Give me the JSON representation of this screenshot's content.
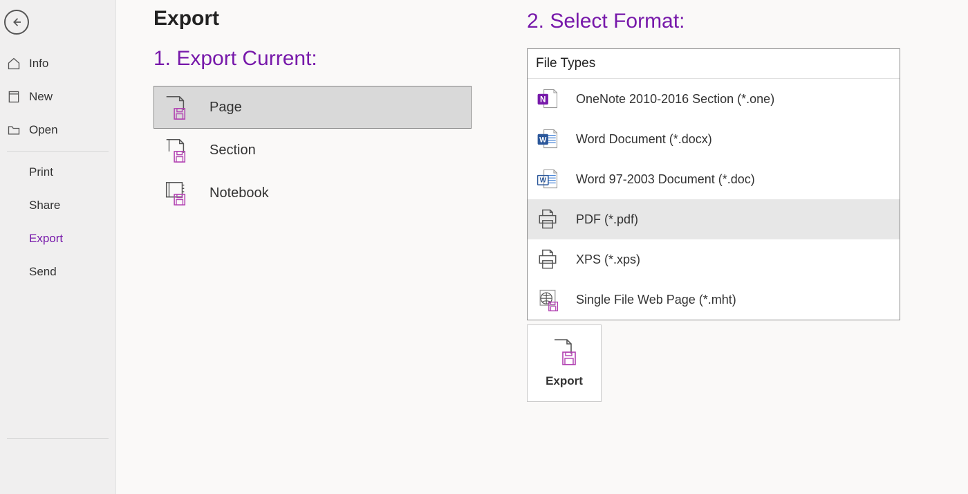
{
  "sidebar": {
    "back_label": "Back",
    "items": [
      {
        "label": "Info",
        "icon": "home-icon"
      },
      {
        "label": "New",
        "icon": "page-icon"
      },
      {
        "label": "Open",
        "icon": "folder-icon"
      }
    ],
    "sub_items": [
      {
        "label": "Print"
      },
      {
        "label": "Share"
      },
      {
        "label": "Export",
        "active": true
      },
      {
        "label": "Send"
      }
    ]
  },
  "main": {
    "title": "Export",
    "col1_heading": "1. Export Current:",
    "export_options": [
      {
        "label": "Page",
        "selected": true
      },
      {
        "label": "Section",
        "selected": false
      },
      {
        "label": "Notebook",
        "selected": false
      }
    ],
    "col2_heading": "2. Select Format:",
    "file_types_header": "File Types",
    "formats": [
      {
        "label": "OneNote 2010-2016 Section (*.one)",
        "icon": "onenote"
      },
      {
        "label": "Word Document (*.docx)",
        "icon": "word"
      },
      {
        "label": "Word 97-2003 Document (*.doc)",
        "icon": "word-old"
      },
      {
        "label": "PDF (*.pdf)",
        "icon": "printer",
        "hover": true
      },
      {
        "label": "XPS (*.xps)",
        "icon": "printer"
      },
      {
        "label": "Single File Web Page (*.mht)",
        "icon": "web"
      }
    ],
    "export_button_label": "Export"
  }
}
